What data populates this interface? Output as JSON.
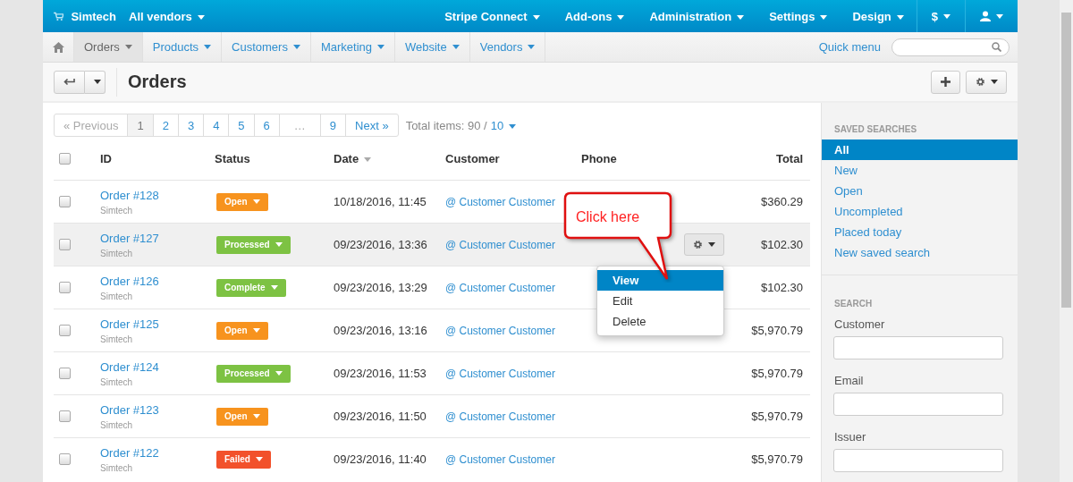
{
  "top_bar": {
    "brand": "Simtech",
    "vendor_selector": "All vendors",
    "menus": [
      {
        "label": "Stripe Connect"
      },
      {
        "label": "Add-ons"
      },
      {
        "label": "Administration"
      },
      {
        "label": "Settings"
      },
      {
        "label": "Design"
      }
    ],
    "currency": "$"
  },
  "nav": {
    "items": [
      {
        "label": "Orders",
        "selected": true
      },
      {
        "label": "Products",
        "selected": false
      },
      {
        "label": "Customers",
        "selected": false
      },
      {
        "label": "Marketing",
        "selected": false
      },
      {
        "label": "Website",
        "selected": false
      },
      {
        "label": "Vendors",
        "selected": false
      }
    ],
    "quick_menu": "Quick menu"
  },
  "page_title": "Orders",
  "pagination": {
    "pages": [
      {
        "label": "« Previous",
        "selected": false,
        "disabled": true
      },
      {
        "label": "1",
        "selected": true,
        "disabled": false
      },
      {
        "label": "2",
        "selected": false,
        "disabled": false
      },
      {
        "label": "3",
        "selected": false,
        "disabled": false
      },
      {
        "label": "4",
        "selected": false,
        "disabled": false
      },
      {
        "label": "5",
        "selected": false,
        "disabled": false
      },
      {
        "label": "6",
        "selected": false,
        "disabled": false
      },
      {
        "label": "…",
        "selected": false,
        "disabled": true
      },
      {
        "label": "9",
        "selected": false,
        "disabled": false
      },
      {
        "label": "Next »",
        "selected": false,
        "disabled": false
      }
    ],
    "total_label": "Total items: 90 /",
    "per_page": "10"
  },
  "table": {
    "select_all_checked": false,
    "columns": [
      "ID",
      "Status",
      "Date",
      "Customer",
      "Phone",
      "Total"
    ],
    "rows": [
      {
        "id": "Order #128",
        "vendor": "Simtech",
        "status": {
          "label": "Open",
          "color": "#f7931e"
        },
        "date": "10/18/2016, 11:45",
        "customer": "@ Customer Customer",
        "total": "$360.29",
        "hovered": false,
        "checked": false
      },
      {
        "id": "Order #127",
        "vendor": "Simtech",
        "status": {
          "label": "Processed",
          "color": "#7dc243"
        },
        "date": "09/23/2016, 13:36",
        "customer": "@ Customer Customer",
        "total": "$102.30",
        "hovered": true,
        "checked": false
      },
      {
        "id": "Order #126",
        "vendor": "Simtech",
        "status": {
          "label": "Complete",
          "color": "#7dc243"
        },
        "date": "09/23/2016, 13:29",
        "customer": "@ Customer Customer",
        "total": "$102.30",
        "hovered": false,
        "checked": false
      },
      {
        "id": "Order #125",
        "vendor": "Simtech",
        "status": {
          "label": "Open",
          "color": "#f7931e"
        },
        "date": "09/23/2016, 13:16",
        "customer": "@ Customer Customer",
        "total": "$5,970.79",
        "hovered": false,
        "checked": false
      },
      {
        "id": "Order #124",
        "vendor": "Simtech",
        "status": {
          "label": "Processed",
          "color": "#7dc243"
        },
        "date": "09/23/2016, 11:53",
        "customer": "@ Customer Customer",
        "total": "$5,970.79",
        "hovered": false,
        "checked": false
      },
      {
        "id": "Order #123",
        "vendor": "Simtech",
        "status": {
          "label": "Open",
          "color": "#f7931e"
        },
        "date": "09/23/2016, 11:50",
        "customer": "@ Customer Customer",
        "total": "$5,970.79",
        "hovered": false,
        "checked": false
      },
      {
        "id": "Order #122",
        "vendor": "Simtech",
        "status": {
          "label": "Failed",
          "color": "#f2512b"
        },
        "date": "09/23/2016, 11:40",
        "customer": "@ Customer Customer",
        "total": "$5,970.79",
        "hovered": false,
        "checked": false
      }
    ],
    "actions_menu": [
      {
        "label": "View",
        "selected": true
      },
      {
        "label": "Edit",
        "selected": false
      },
      {
        "label": "Delete",
        "selected": false
      }
    ]
  },
  "callout": "Click here",
  "sidebar": {
    "saved_searches_title": "SAVED SEARCHES",
    "saved_searches": [
      {
        "label": "All",
        "selected": true
      },
      {
        "label": "New",
        "selected": false
      },
      {
        "label": "Open",
        "selected": false
      },
      {
        "label": "Uncompleted",
        "selected": false
      },
      {
        "label": "Placed today",
        "selected": false
      },
      {
        "label": "New saved search",
        "selected": false
      }
    ],
    "search_title": "SEARCH",
    "fields": [
      {
        "label": "Customer"
      },
      {
        "label": "Email"
      },
      {
        "label": "Issuer"
      }
    ]
  }
}
